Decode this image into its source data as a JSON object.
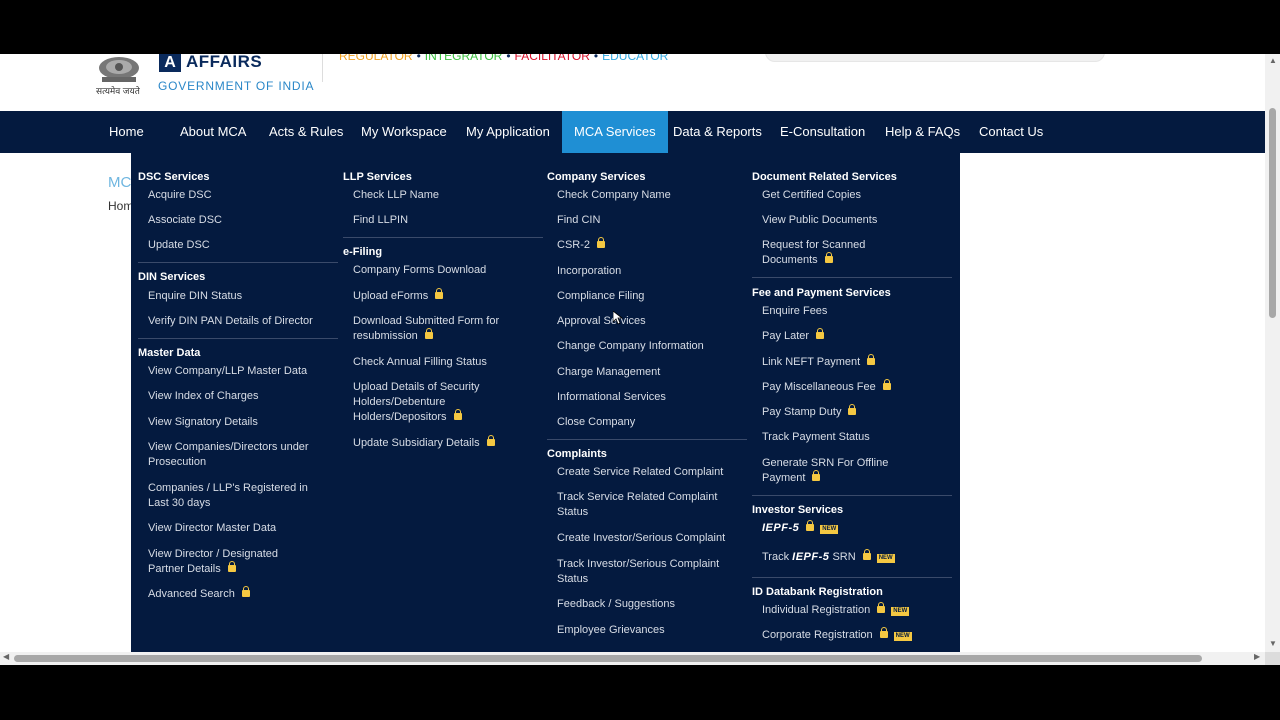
{
  "header": {
    "emblem_motto": "सत्यमेव जयते",
    "logo_letter": "A",
    "logo_text": "AFFAIRS",
    "gov_text": "GOVERNMENT OF INDIA",
    "tagline": [
      {
        "text": "REGULATOR",
        "color": "#f0a020"
      },
      {
        "text": "INTEGRATOR",
        "color": "#3cc040"
      },
      {
        "text": "FACILITATOR",
        "color": "#d8102a"
      },
      {
        "text": "EDUCATOR",
        "color": "#30a8e0"
      }
    ],
    "tagline_sep": "•"
  },
  "nav": {
    "items": [
      "Home",
      "About MCA",
      "Acts & Rules",
      "My Workspace",
      "My Application",
      "MCA Services",
      "Data & Reports",
      "E-Consultation",
      "Help & FAQs",
      "Contact Us"
    ],
    "active": "MCA Services"
  },
  "background": {
    "title_fragment": "MC",
    "breadcrumb_fragment": "Hom"
  },
  "menu": {
    "dsc": {
      "title": "DSC Services",
      "items": [
        "Acquire DSC",
        "Associate DSC",
        "Update DSC"
      ]
    },
    "din": {
      "title": "DIN Services",
      "items": [
        "Enquire DIN Status",
        "Verify DIN PAN Details of Director"
      ]
    },
    "master": {
      "title": "Master Data",
      "items": [
        "View Company/LLP Master Data",
        "View Index of Charges",
        "View Signatory Details",
        "View Companies/Directors under Prosecution",
        "Companies / LLP's Registered in Last 30 days",
        "View Director Master Data",
        "View Director / Designated Partner Details",
        "Advanced Search"
      ]
    },
    "llp": {
      "title": "LLP Services",
      "items": [
        "Check LLP Name",
        "Find LLPIN"
      ]
    },
    "efiling": {
      "title": "e-Filing",
      "items": [
        "Company Forms Download",
        "Upload eForms",
        "Download Submitted Form for resubmission",
        "Check Annual Filling Status",
        "Upload Details of Security Holders/Debenture Holders/Depositors",
        "Update Subsidiary Details"
      ]
    },
    "company": {
      "title": "Company Services",
      "items": [
        "Check Company Name",
        "Find CIN",
        "CSR-2",
        "Incorporation",
        "Compliance Filing",
        "Approval Services",
        "Change Company Information",
        "Charge Management",
        "Informational Services",
        "Close Company"
      ]
    },
    "complaints": {
      "title": "Complaints",
      "items": [
        "Create Service Related Complaint",
        "Track Service Related Complaint Status",
        "Create Investor/Serious Complaint",
        "Track Investor/Serious Complaint Status",
        "Feedback / Suggestions",
        "Employee Grievances"
      ]
    },
    "docs": {
      "title": "Document Related Services",
      "items": [
        "Get Certified Copies",
        "View Public Documents",
        "Request for Scanned Documents"
      ]
    },
    "fee": {
      "title": "Fee and Payment Services",
      "items": [
        "Enquire Fees",
        "Pay Later",
        "Link NEFT Payment",
        "Pay Miscellaneous Fee",
        "Pay Stamp Duty",
        "Track Payment Status",
        "Generate SRN For Offline Payment"
      ]
    },
    "investor": {
      "title": "Investor Services",
      "iepf": "IEPF-5",
      "track_prefix": "Track",
      "track_suffix": "SRN"
    },
    "iddb": {
      "title": "ID Databank Registration",
      "items": [
        "Individual Registration",
        "Corporate Registration"
      ]
    },
    "new_badge": "NEW"
  },
  "colors": {
    "nav_bg": "#041a3f",
    "active_tab": "#1f8fd4",
    "lock": "#f5c842"
  }
}
